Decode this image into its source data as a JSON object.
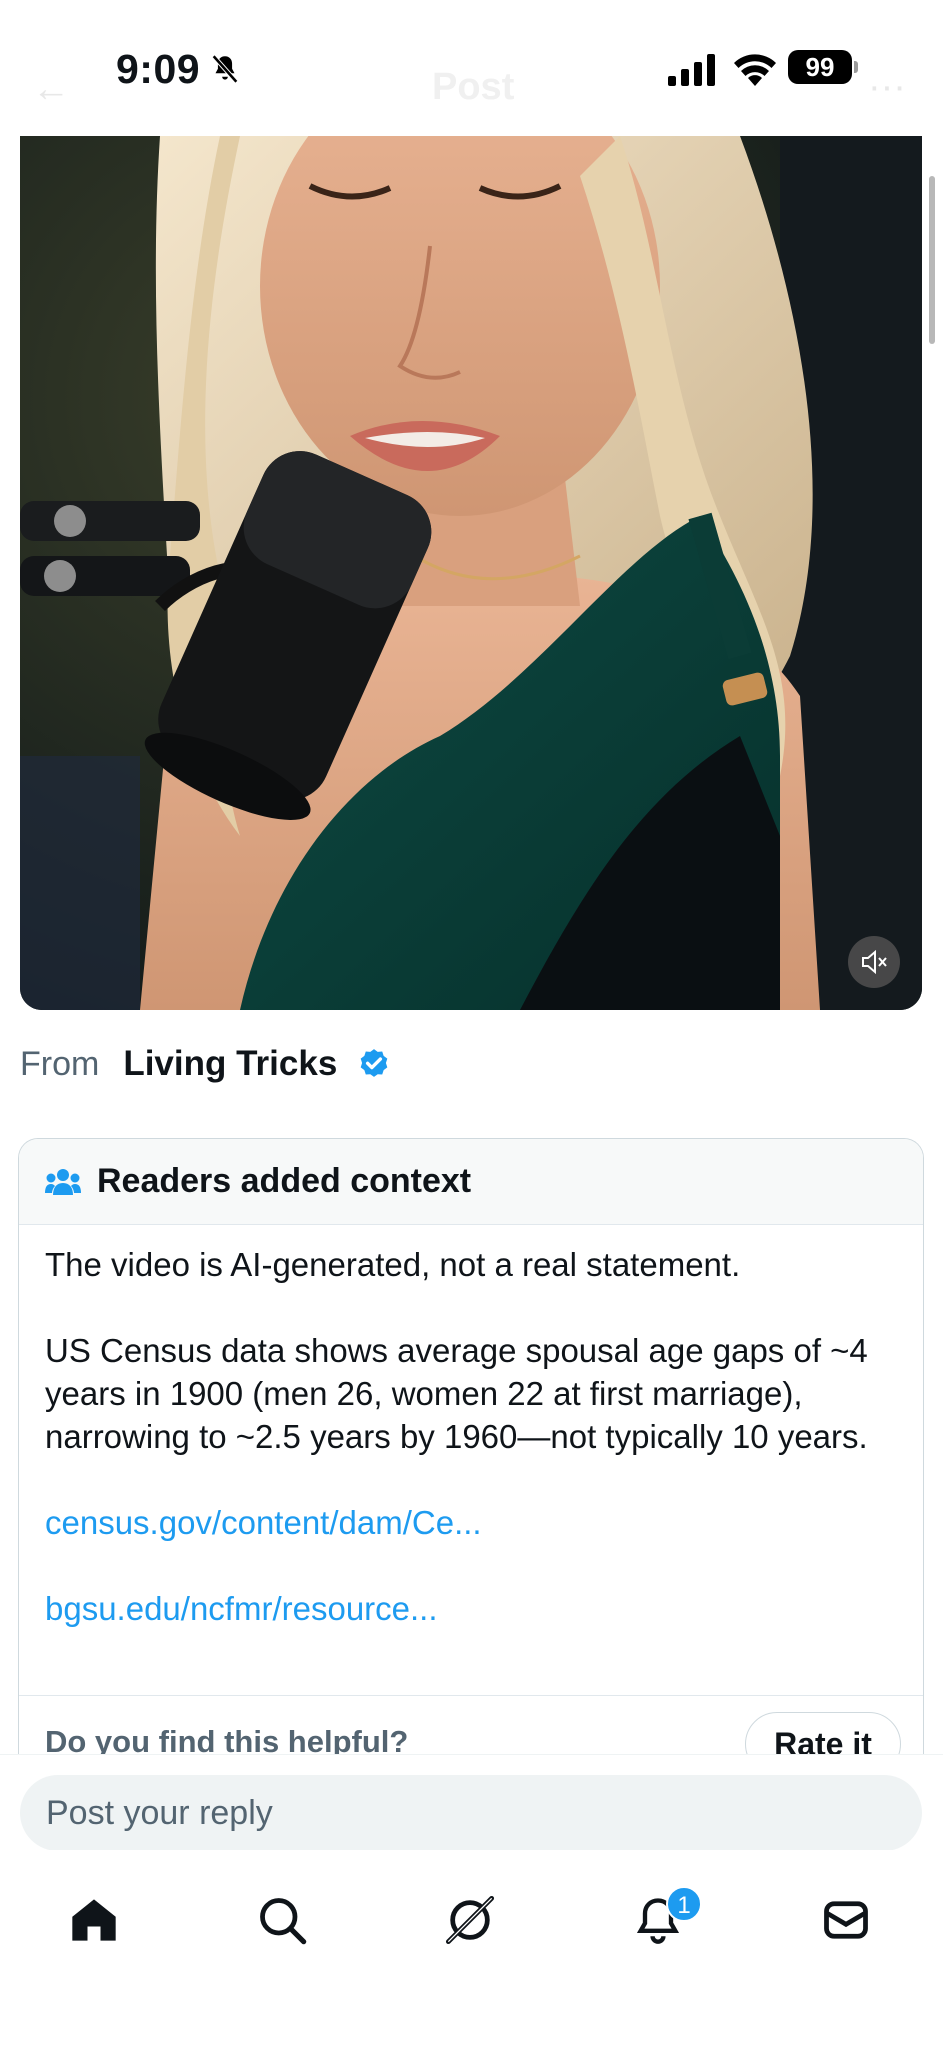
{
  "status_bar": {
    "time": "9:09",
    "battery": "99"
  },
  "header": {
    "title": "Post"
  },
  "post": {
    "from_label": "From",
    "source_name": "Living Tricks"
  },
  "note": {
    "heading": "Readers added context",
    "paragraphs": [
      "The video is AI-generated, not a real statement.",
      "US Census data shows average spousal age gaps of ~4 years in 1900 (men 26, women 22 at first marriage), narrowing to ~2.5 years by 1960—not typically 10 years."
    ],
    "links": [
      "census.gov/content/dam/Ce...",
      "bgsu.edu/ncfmr/resource..."
    ],
    "helpful_question": "Do you find this helpful?",
    "rate_label": "Rate it"
  },
  "reply": {
    "placeholder": "Post your reply"
  },
  "tab_bar": {
    "notifications_badge": "1"
  },
  "colors": {
    "accent": "#1d9bf0",
    "text_primary": "#0f1419",
    "text_secondary": "#536471",
    "note_header_bg": "#f7f9f9"
  },
  "icons": {
    "status": [
      "bell-slash-icon",
      "signal-icon",
      "wifi-icon",
      "battery-icon"
    ],
    "video": [
      "mute-icon"
    ],
    "tabs": [
      "home-icon",
      "search-icon",
      "grok-icon",
      "notifications-icon",
      "messages-icon"
    ]
  }
}
